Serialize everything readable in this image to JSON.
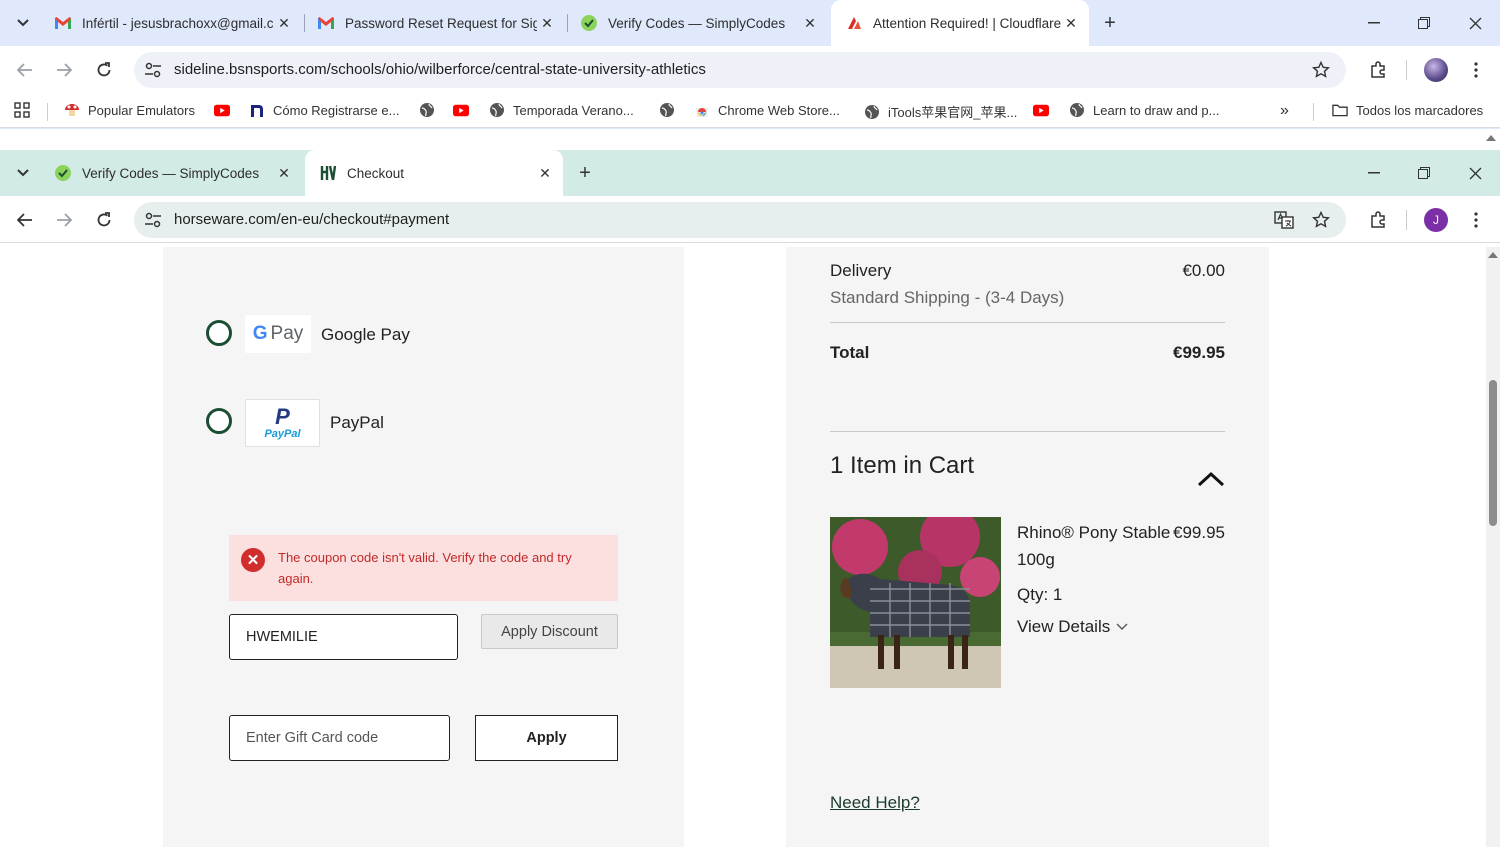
{
  "outer_window": {
    "tabs": [
      {
        "title": "Infértil - jesusbrachoxx@gmail.c",
        "icon": "gmail-icon"
      },
      {
        "title": "Password Reset Request for Sig",
        "icon": "gmail-icon"
      },
      {
        "title": "Verify Codes — SimplyCodes",
        "icon": "simplycodes-icon"
      },
      {
        "title": "Attention Required! | Cloudflare",
        "icon": "cloudflare-icon",
        "active": true
      }
    ],
    "url": "sideline.bsnsports.com/schools/ohio/wilberforce/central-state-university-athletics",
    "bookmarks": [
      {
        "label": "Popular Emulators",
        "icon": "mushroom-icon"
      },
      {
        "label": "",
        "icon": "youtube-icon"
      },
      {
        "label": "Cómo Registrarse e...",
        "icon": "n-logo-icon"
      },
      {
        "label": "",
        "icon": "globe-icon"
      },
      {
        "label": "",
        "icon": "youtube-icon"
      },
      {
        "label": "Temporada Verano...",
        "icon": "globe-icon"
      },
      {
        "label": "",
        "icon": "globe-icon"
      },
      {
        "label": "Chrome Web Store...",
        "icon": "chrome-webstore-icon"
      },
      {
        "label": "iTools苹果官网_苹果...",
        "icon": "globe-icon"
      },
      {
        "label": "",
        "icon": "youtube-icon"
      },
      {
        "label": "Learn to draw and p...",
        "icon": "globe-icon"
      }
    ],
    "all_bookmarks": "Todos los marcadores"
  },
  "inner_window": {
    "tabs": [
      {
        "title": "Verify Codes — SimplyCodes",
        "icon": "simplycodes-icon"
      },
      {
        "title": "Checkout",
        "icon": "horseware-icon",
        "active": true
      }
    ],
    "url": "horseware.com/en-eu/checkout#payment",
    "profile_initial": "J"
  },
  "payment": {
    "options": [
      {
        "label": "Google Pay",
        "badge": "G Pay"
      },
      {
        "label": "PayPal",
        "badge_top": "P",
        "badge_bottom": "PayPal"
      }
    ],
    "error_message": "The coupon code isn't valid. Verify the code and try again.",
    "discount_value": "HWEMILIE",
    "apply_discount_label": "Apply Discount",
    "gift_card_placeholder": "Enter Gift Card code",
    "apply_label": "Apply"
  },
  "summary": {
    "delivery_label": "Delivery",
    "delivery_value": "€0.00",
    "shipping_method": "Standard Shipping - (3-4 Days)",
    "total_label": "Total",
    "total_value": "€99.95",
    "cart_heading": "1 Item in Cart",
    "item_name": "Rhino® Pony Stable",
    "item_name_line2": "100g",
    "item_price": "€99.95",
    "item_qty": "Qty: 1",
    "view_details": "View Details",
    "need_help": "Need Help?"
  },
  "colors": {
    "outer_tabstrip": "#dfe9fb",
    "inner_tabstrip": "#d2ebe7",
    "radio_green": "#1c4e34",
    "error_bg": "#fbe0df",
    "error_text": "#c22a2a",
    "panel_bg": "#f5f5f5"
  }
}
